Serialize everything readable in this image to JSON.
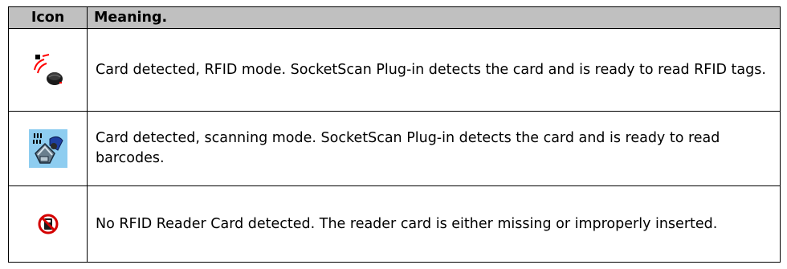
{
  "table": {
    "header": {
      "icon_label": "Icon",
      "meaning_label": "Meaning."
    },
    "rows": [
      {
        "icon": "rfid-card-detected-icon",
        "meaning": "Card detected, RFID mode. SocketScan Plug-in detects the card and is ready to read RFID tags."
      },
      {
        "icon": "barcode-scanner-mode-icon",
        "meaning": "Card detected, scanning mode. SocketScan Plug-in detects the card and is ready to read barcodes."
      },
      {
        "icon": "no-rfid-card-icon",
        "meaning": "No RFID Reader Card detected. The reader card is either missing or improperly inserted."
      }
    ]
  },
  "colors": {
    "header_background": "#c0c0c0",
    "border": "#000000",
    "scanner_icon_background": "#8ecdf0",
    "no_card_red": "#d40000",
    "rfid_waves_red": "#ff0000"
  }
}
